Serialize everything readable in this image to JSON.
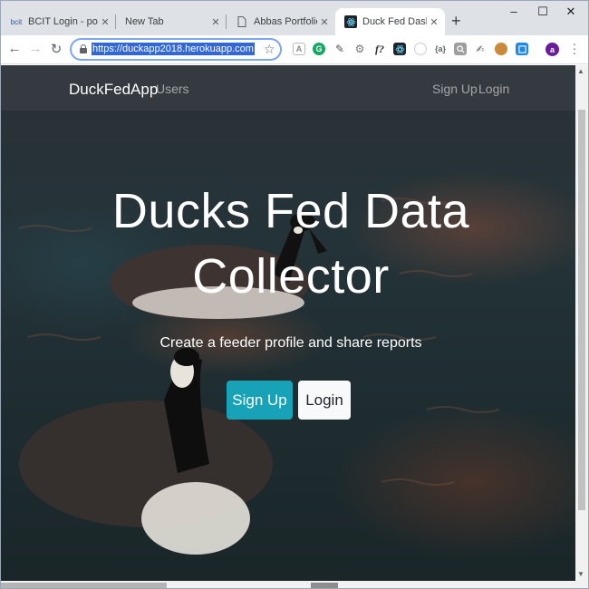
{
  "browser": {
    "tabs": [
      {
        "favicon": "bcit-icon",
        "favicon_text": "bcit",
        "title": "BCIT Login - powere",
        "active": false
      },
      {
        "favicon": "",
        "favicon_text": "",
        "title": "New Tab",
        "active": false
      },
      {
        "favicon": "page-icon",
        "favicon_text": "",
        "title": "Abbas Portfolio",
        "active": false
      },
      {
        "favicon": "react-icon",
        "favicon_text": "",
        "title": "Duck Fed Dashboard",
        "active": true
      }
    ],
    "new_tab_symbol": "+",
    "window_controls": {
      "minimize": "–",
      "maximize": "☐",
      "close": "✕"
    },
    "address": {
      "url": "https://duckapp2018.herokuapp.com"
    },
    "profile_initial": "a"
  },
  "page": {
    "navbar": {
      "brand": "DuckFedApp",
      "users": "Users",
      "signup": "Sign Up",
      "login": "Login"
    },
    "hero": {
      "headline_line1": "Ducks Fed Data",
      "headline_line2": "Collector",
      "lead": "Create a feeder profile and share reports",
      "signup_button": "Sign Up",
      "login_button": "Login"
    }
  },
  "colors": {
    "navbar_bg": "#343a40",
    "signup_btn": "#17a2b8",
    "login_btn": "#f8f9fa",
    "url_highlight": "#3367d6"
  }
}
